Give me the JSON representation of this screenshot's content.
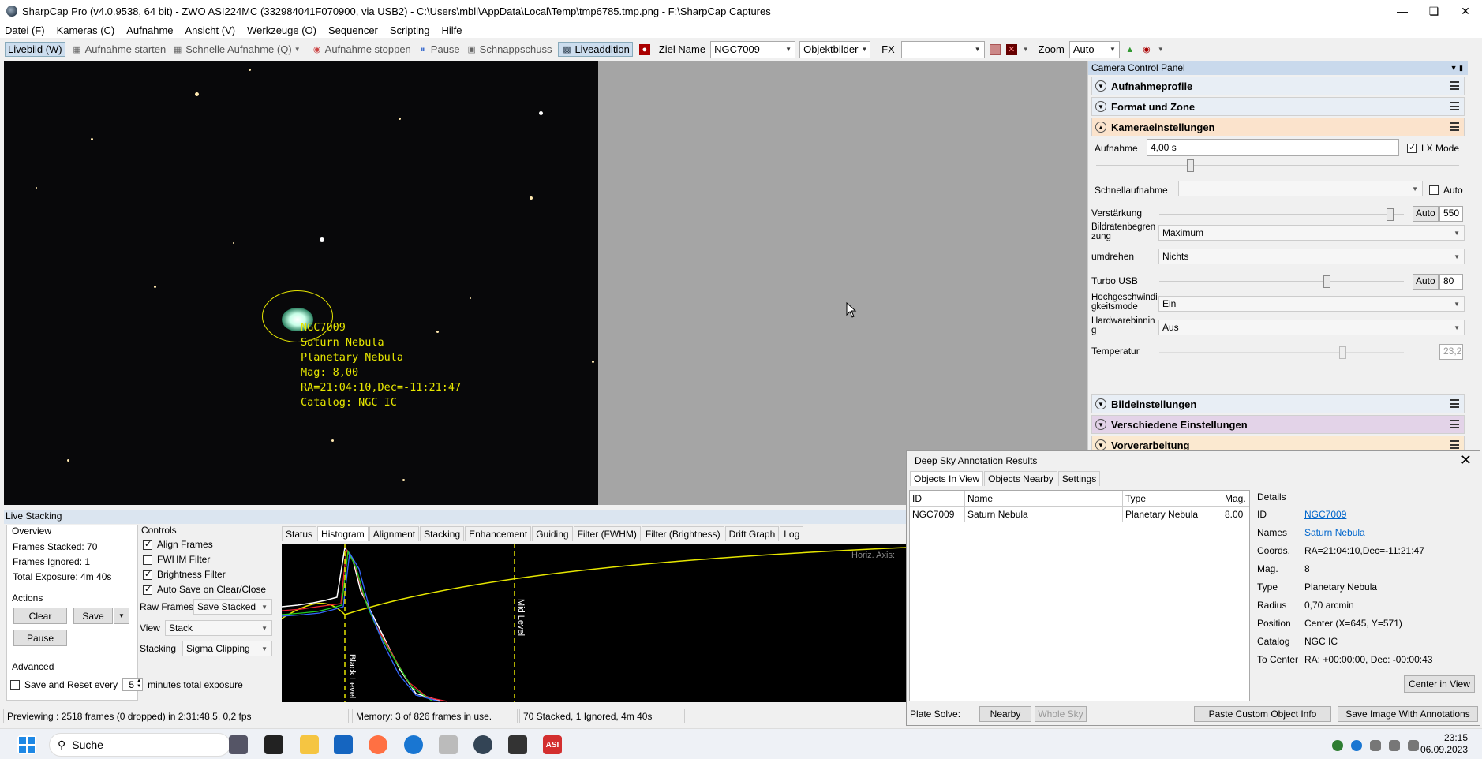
{
  "titlebar": {
    "title": "SharpCap Pro (v4.0.9538, 64 bit) - ZWO ASI224MC (332984041F070900, via USB2) - C:\\Users\\mbll\\AppData\\Local\\Temp\\tmp6785.tmp.png - F:\\SharpCap Captures"
  },
  "menu": [
    "Datei (F)",
    "Kameras (C)",
    "Aufnahme",
    "Ansicht (V)",
    "Werkzeuge (O)",
    "Sequencer",
    "Scripting",
    "Hilfe"
  ],
  "toolbar": {
    "livebild": "Livebild (W)",
    "aufnahme_starten": "Aufnahme starten",
    "schnelle": "Schnelle Aufnahme (Q)",
    "stoppen": "Aufnahme stoppen",
    "pause": "Pause",
    "schnappschuss": "Schnappschuss",
    "liveaddition": "Liveaddition",
    "ziel_label": "Ziel Name",
    "ziel_value": "NGC7009",
    "objektbilder": "Objektbilder",
    "fx": "FX",
    "fx_value": "",
    "zoom_label": "Zoom",
    "zoom_value": "Auto"
  },
  "annotation": {
    "line1": "NGC7009",
    "line2": "Saturn Nebula",
    "line3": "Planetary Nebula",
    "line4": "Mag: 8,00",
    "line5": "RA=21:04:10,Dec=-11:21:47",
    "line6": "Catalog: NGC IC"
  },
  "ccp": {
    "title": "Camera Control Panel",
    "aufnahmeprofile": "Aufnahmeprofile",
    "format": "Format und Zone",
    "kamera": "Kameraeinstellungen",
    "aufnahme_label": "Aufnahme",
    "aufnahme_value": "4,00 s",
    "lx_mode": "LX Mode",
    "schnell_label": "Schnellaufnahme",
    "auto": "Auto",
    "verst_label": "Verstärkung",
    "verst_auto": "Auto",
    "verst_value": "550",
    "bildraten_label": "Bildratenbegren zung",
    "bildraten_value": "Maximum",
    "umdrehen_label": "umdrehen",
    "umdrehen_value": "Nichts",
    "turbo_label": "Turbo USB",
    "turbo_auto": "Auto",
    "turbo_value": "80",
    "hochgesch_label": "Hochgeschwindi gkeitsmode",
    "hochgesch_value": "Ein",
    "hwbin_label": "Hardwarebinnin g",
    "hwbin_value": "Aus",
    "temp_label": "Temperatur",
    "temp_value": "23,2",
    "bildeinst": "Bildeinstellungen",
    "verschiedene": "Verschiedene Einstellungen",
    "vorverarbeitung": "Vorverarbeitung"
  },
  "livestacking": {
    "title": "Live Stacking",
    "overview": "Overview",
    "frames_stacked": "Frames Stacked: 70",
    "frames_ignored": "Frames Ignored: 1",
    "total_exposure": "Total Exposure:  4m 40s",
    "actions": "Actions",
    "clear": "Clear",
    "save": "Save",
    "pause": "Pause",
    "advanced": "Advanced",
    "save_reset": "Save and Reset every",
    "minutes_value": "5",
    "minutes_text": "minutes total exposure",
    "controls": "Controls",
    "align": "Align Frames",
    "fwhm": "FWHM Filter",
    "brightness": "Brightness Filter",
    "autosave": "Auto Save on Clear/Close",
    "raw_label": "Raw Frames",
    "raw_value": "Save Stacked",
    "view_label": "View",
    "view_value": "Stack",
    "stacking_label": "Stacking",
    "stacking_value": "Sigma Clipping",
    "tabs": [
      "Status",
      "Histogram",
      "Alignment",
      "Stacking",
      "Enhancement",
      "Guiding",
      "Filter (FWHM)",
      "Filter (Brightness)",
      "Drift Graph",
      "Log"
    ],
    "horiz_axis": "Horiz. Axis:",
    "black_level": "Black Level",
    "mid_level": "Mid Level"
  },
  "dsa": {
    "title": "Deep Sky Annotation Results",
    "tabs": [
      "Objects In View",
      "Objects Nearby",
      "Settings"
    ],
    "columns": [
      "ID",
      "Name",
      "Type",
      "Mag."
    ],
    "rows": [
      [
        "NGC7009",
        "Saturn Nebula",
        "Planetary Nebula",
        "8.00"
      ]
    ],
    "details_title": "Details",
    "details": [
      [
        "ID",
        "NGC7009"
      ],
      [
        "Names",
        "Saturn Nebula"
      ],
      [
        "Coords.",
        "RA=21:04:10,Dec=-11:21:47"
      ],
      [
        "Mag.",
        "8"
      ],
      [
        "Type",
        "Planetary Nebula"
      ],
      [
        "Radius",
        "0,70 arcmin"
      ],
      [
        "Position",
        "Center (X=645, Y=571)"
      ],
      [
        "Catalog",
        "NGC IC"
      ],
      [
        "To Center",
        "RA: +00:00:00, Dec: -00:00:43"
      ]
    ],
    "center_btn": "Center in View",
    "plate_solve": "Plate Solve:",
    "nearby": "Nearby",
    "whole_sky": "Whole Sky",
    "paste_custom": "Paste Custom Object Info",
    "save_image": "Save Image With Annotations"
  },
  "status": {
    "previewing": "Previewing : 2518 frames (0 dropped) in 2:31:48,5, 0,2 fps",
    "memory": "Memory: 3 of 826 frames in use.",
    "stacked": "70 Stacked, 1 Ignored, 4m 40s"
  },
  "taskbar": {
    "search": "Suche",
    "time": "23:15",
    "date": "06.09.2023"
  }
}
